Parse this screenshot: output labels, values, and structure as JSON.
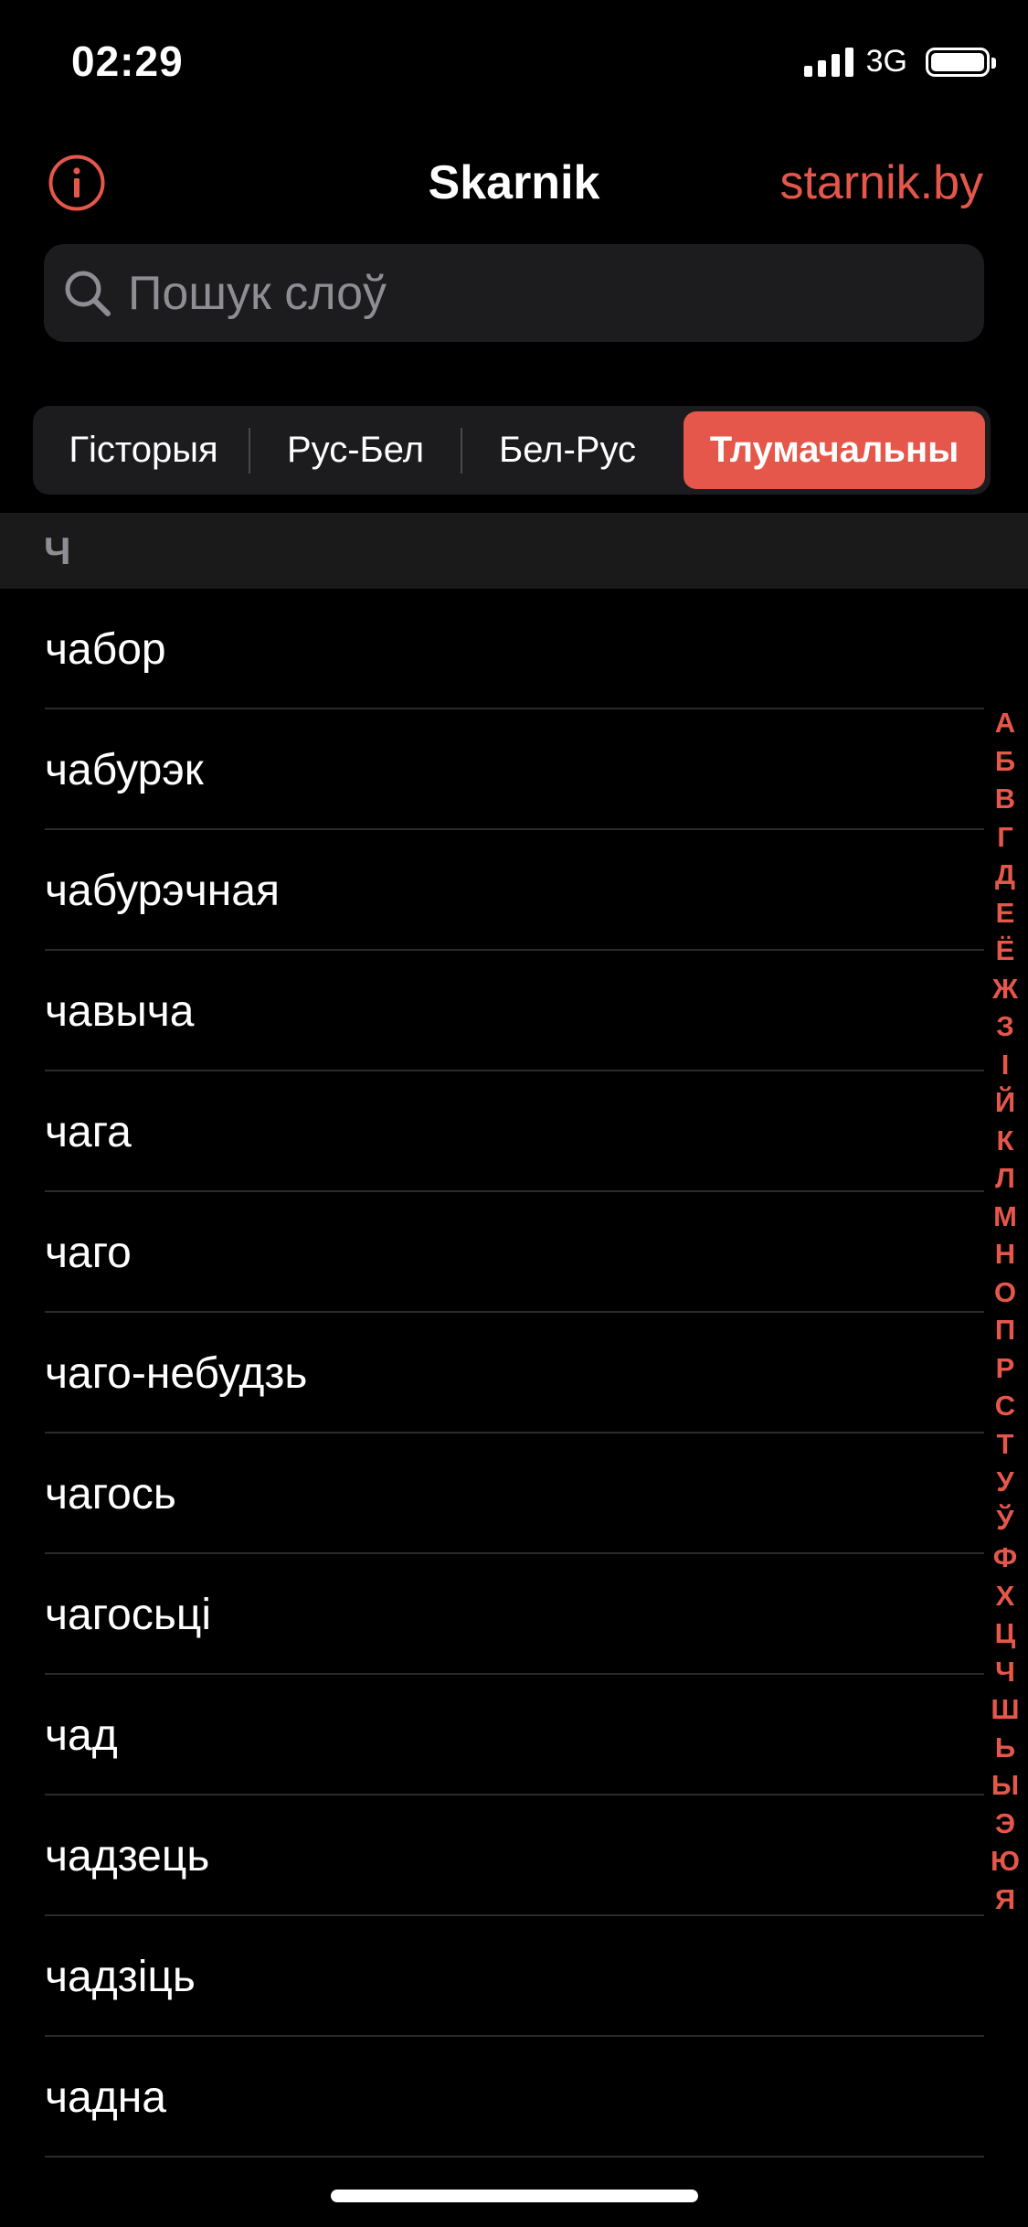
{
  "status_bar": {
    "time": "02:29",
    "network": "3G"
  },
  "nav": {
    "info_icon": "info-circle-icon",
    "title": "Skarnik",
    "link": "starnik.by"
  },
  "search": {
    "placeholder": "Пошук слоў",
    "value": "",
    "icon": "search-icon"
  },
  "segments": [
    {
      "label": "Гісторыя",
      "selected": false
    },
    {
      "label": "Рус-Бел",
      "selected": false
    },
    {
      "label": "Бел-Рус",
      "selected": false
    },
    {
      "label": "Тлумачальны",
      "selected": true
    }
  ],
  "section": {
    "letter": "Ч"
  },
  "words": [
    "чабор",
    "чабурэк",
    "чабурэчная",
    "чавыча",
    "чага",
    "чаго",
    "чаго-небудзь",
    "чагось",
    "чагосьці",
    "чад",
    "чадзець",
    "чадзіць",
    "чадна"
  ],
  "alphabet_index": [
    "А",
    "Б",
    "В",
    "Г",
    "Д",
    "Е",
    "Ё",
    "Ж",
    "З",
    "І",
    "Й",
    "К",
    "Л",
    "М",
    "Н",
    "О",
    "П",
    "Р",
    "С",
    "Т",
    "У",
    "Ў",
    "Ф",
    "Х",
    "Ц",
    "Ч",
    "Ш",
    "Ь",
    "Ы",
    "Э",
    "Ю",
    "Я"
  ],
  "colors": {
    "accent": "#e4574a",
    "background": "#000000",
    "control_bg": "#1c1c1e"
  }
}
